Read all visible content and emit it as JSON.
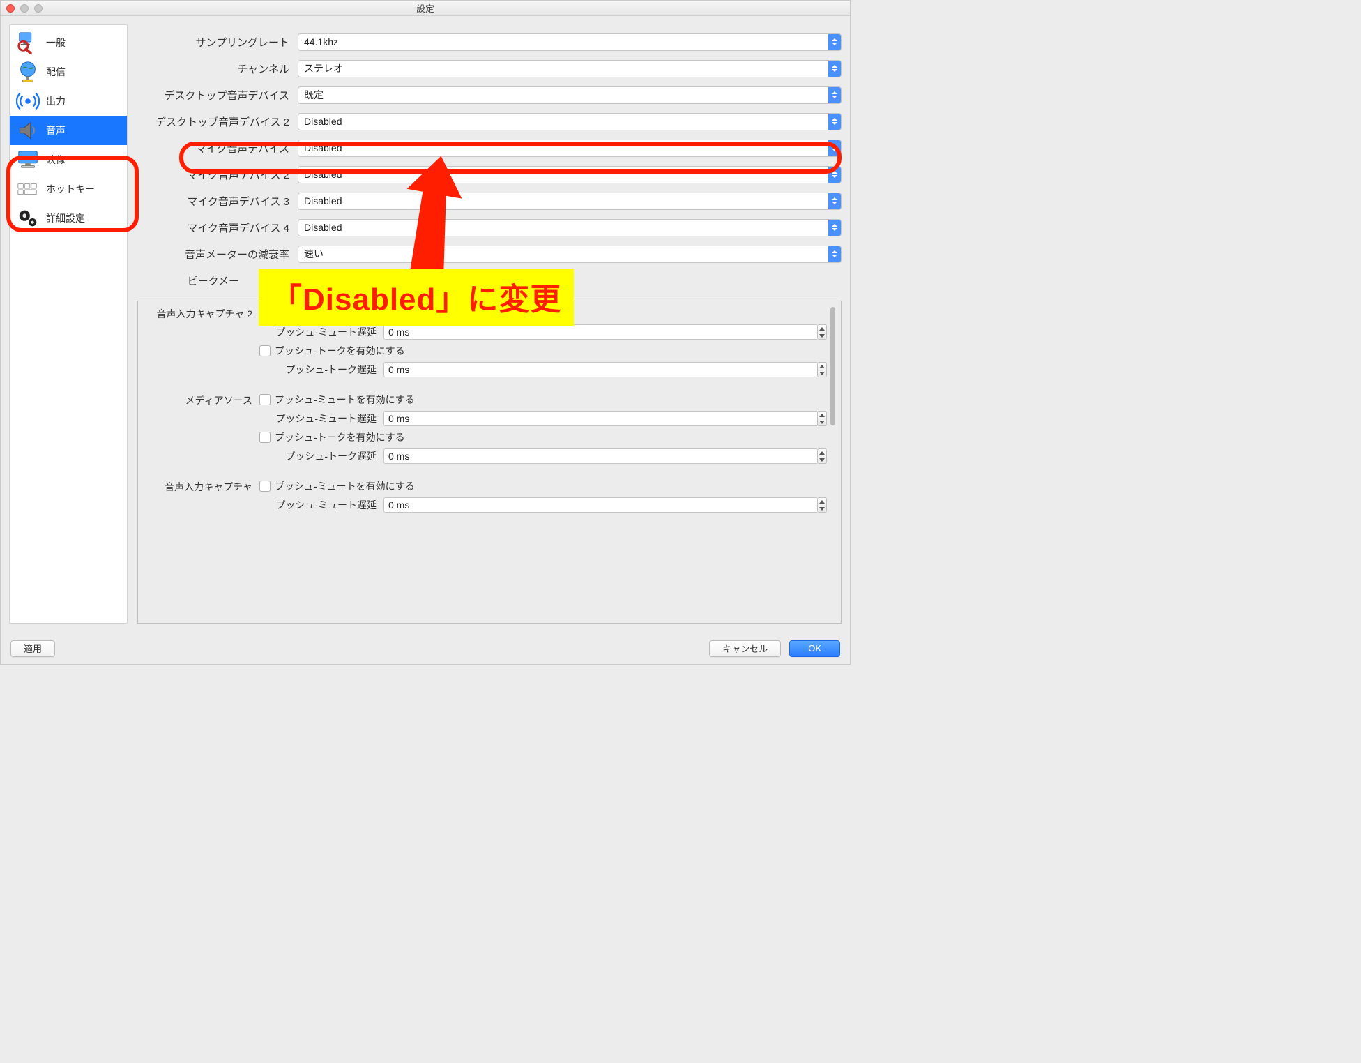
{
  "window": {
    "title": "設定"
  },
  "sidebar": {
    "items": [
      {
        "label": "一般"
      },
      {
        "label": "配信"
      },
      {
        "label": "出力"
      },
      {
        "label": "音声"
      },
      {
        "label": "映像"
      },
      {
        "label": "ホットキー"
      },
      {
        "label": "詳細設定"
      }
    ]
  },
  "form": {
    "sample_rate_label": "サンプリングレート",
    "sample_rate_value": "44.1khz",
    "channel_label": "チャンネル",
    "channel_value": "ステレオ",
    "desktop1_label": "デスクトップ音声デバイス",
    "desktop1_value": "既定",
    "desktop2_label": "デスクトップ音声デバイス 2",
    "desktop2_value": "Disabled",
    "mic1_label": "マイク音声デバイス",
    "mic1_value": "Disabled",
    "mic2_label": "マイク音声デバイス 2",
    "mic2_value": "Disabled",
    "mic3_label": "マイク音声デバイス 3",
    "mic3_value": "Disabled",
    "mic4_label": "マイク音声デバイス 4",
    "mic4_value": "Disabled",
    "decay_label": "音声メーターの減衰率",
    "decay_value": "速い",
    "peak_label": "ピークメー"
  },
  "groups": {
    "g1_label": "音声入力キャプチャ 2",
    "g2_label": "メディアソース",
    "g3_label": "音声入力キャプチャ",
    "push_mute_enable": "プッシュ-ミュートを有効にする",
    "push_mute_delay_label": "プッシュ-ミュート遅延",
    "push_talk_enable": "プッシュ-トークを有効にする",
    "push_talk_delay_label": "プッシュ-トーク遅延",
    "delay_value": "0 ms"
  },
  "buttons": {
    "apply": "適用",
    "cancel": "キャンセル",
    "ok": "OK"
  },
  "annotation": {
    "callout": "「Disabled」に変更"
  }
}
